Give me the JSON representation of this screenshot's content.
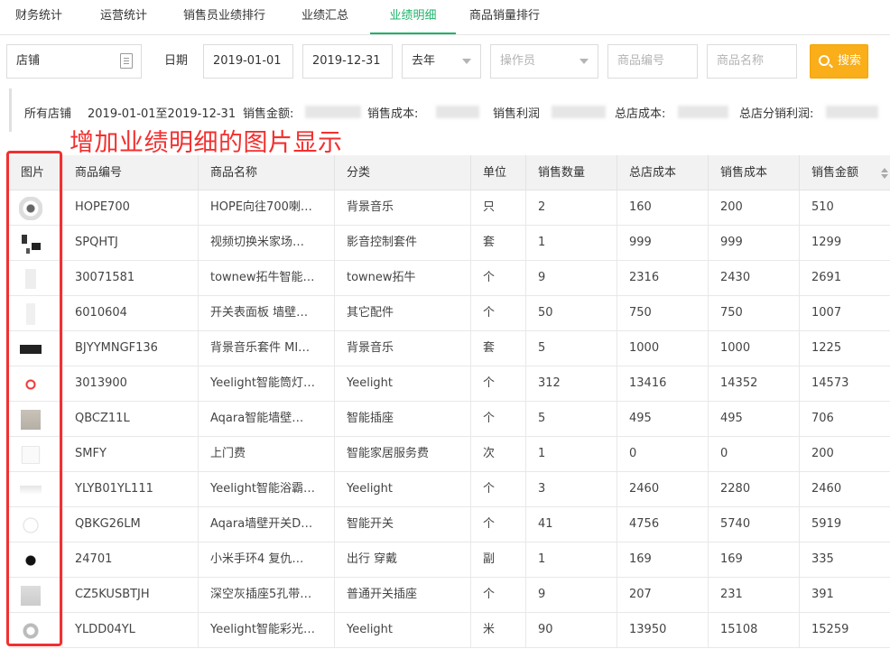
{
  "tabs": [
    {
      "label": "财务统计"
    },
    {
      "label": "运营统计"
    },
    {
      "label": "销售员业绩排行"
    },
    {
      "label": "业绩汇总"
    },
    {
      "label": "业绩明细"
    },
    {
      "label": "商品销量排行"
    }
  ],
  "filters": {
    "store_value": "店铺",
    "date_label": "日期",
    "date_from": "2019-01-01",
    "date_to": "2019-12-31",
    "period_value": "去年",
    "operator_placeholder": "操作员",
    "product_code_placeholder": "商品编号",
    "product_name_placeholder": "商品名称",
    "search_label": "搜索"
  },
  "summary": {
    "store": "所有店铺",
    "date_range": "2019-01-01至2019-12-31",
    "sales_amount_label": "销售金额:",
    "sales_cost_label": "销售成本:",
    "sales_profit_label": "销售利润",
    "hq_cost_label": "总店成本:",
    "hq_profit_label": "总店分销利润:"
  },
  "annotation": "增加业绩明细的图片显示",
  "table": {
    "headers": [
      "图片",
      "商品编号",
      "商品名称",
      "分类",
      "单位",
      "销售数量",
      "总店成本",
      "销售成本",
      "销售金额"
    ],
    "rows": [
      {
        "code": "HOPE700",
        "name": "HOPE向往700喇…",
        "category": "背景音乐",
        "unit": "只",
        "qty": "2",
        "hq_cost": "160",
        "cost": "200",
        "amount": "510"
      },
      {
        "code": "SPQHTJ",
        "name": "视频切换米家场…",
        "category": "影音控制套件",
        "unit": "套",
        "qty": "1",
        "hq_cost": "999",
        "cost": "999",
        "amount": "1299"
      },
      {
        "code": "30071581",
        "name": "townew拓牛智能…",
        "category": "townew拓牛",
        "unit": "个",
        "qty": "9",
        "hq_cost": "2316",
        "cost": "2430",
        "amount": "2691"
      },
      {
        "code": "6010604",
        "name": "开关表面板 墙壁…",
        "category": "其它配件",
        "unit": "个",
        "qty": "50",
        "hq_cost": "750",
        "cost": "750",
        "amount": "1007"
      },
      {
        "code": "BJYYMNGF136",
        "name": "背景音乐套件 MI…",
        "category": "背景音乐",
        "unit": "套",
        "qty": "5",
        "hq_cost": "1000",
        "cost": "1000",
        "amount": "1225"
      },
      {
        "code": "3013900",
        "name": "Yeelight智能筒灯…",
        "category": "Yeelight",
        "unit": "个",
        "qty": "312",
        "hq_cost": "13416",
        "cost": "14352",
        "amount": "14573"
      },
      {
        "code": "QBCZ11L",
        "name": "Aqara智能墙壁…",
        "category": "智能插座",
        "unit": "个",
        "qty": "5",
        "hq_cost": "495",
        "cost": "495",
        "amount": "706"
      },
      {
        "code": "SMFY",
        "name": "上门费",
        "category": "智能家居服务费",
        "unit": "次",
        "qty": "1",
        "hq_cost": "0",
        "cost": "0",
        "amount": "200"
      },
      {
        "code": "YLYB01YL111",
        "name": "Yeelight智能浴霸…",
        "category": "Yeelight",
        "unit": "个",
        "qty": "3",
        "hq_cost": "2460",
        "cost": "2280",
        "amount": "2460"
      },
      {
        "code": "QBKG26LM",
        "name": "Aqara墙壁开关D…",
        "category": "智能开关",
        "unit": "个",
        "qty": "41",
        "hq_cost": "4756",
        "cost": "5740",
        "amount": "5919"
      },
      {
        "code": "24701",
        "name": "小米手环4 复仇…",
        "category": "出行 穿戴",
        "unit": "副",
        "qty": "1",
        "hq_cost": "169",
        "cost": "169",
        "amount": "335"
      },
      {
        "code": "CZ5KUSBTJH",
        "name": "深空灰插座5孔带…",
        "category": "普通开关插座",
        "unit": "个",
        "qty": "9",
        "hq_cost": "207",
        "cost": "231",
        "amount": "391"
      },
      {
        "code": "YLDD04YL",
        "name": "Yeelight智能彩光…",
        "category": "Yeelight",
        "unit": "米",
        "qty": "90",
        "hq_cost": "13950",
        "cost": "15108",
        "amount": "15259"
      }
    ]
  },
  "colors": {
    "accent": "#1fb36b",
    "search_button": "#f9ae1a",
    "annotation": "#f2302f"
  }
}
